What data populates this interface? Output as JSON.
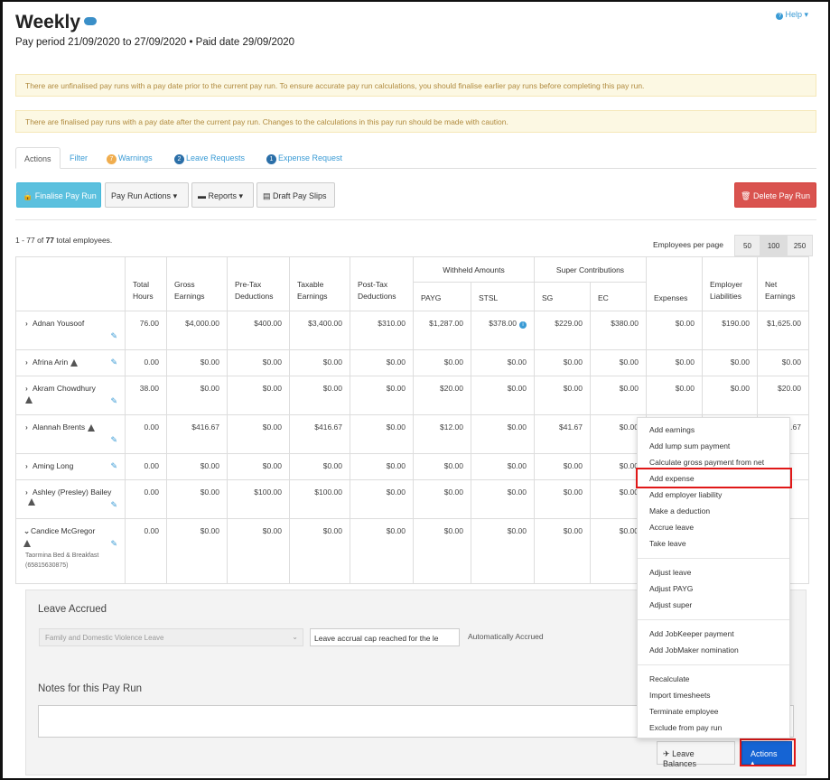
{
  "header": {
    "title": "Weekly",
    "subtitle": "Pay period 21/09/2020 to 27/09/2020 • Paid date 29/09/2020",
    "help": "Help"
  },
  "alerts": [
    "There are unfinalised pay runs with a pay date prior to the current pay run. To ensure accurate pay run calculations, you should finalise earlier pay runs before completing this pay run.",
    "There are finalised pay runs with a pay date after the current pay run. Changes to the calculations in this pay run should be made with caution."
  ],
  "tabs": [
    {
      "label": "Actions",
      "badge": ""
    },
    {
      "label": "Filter",
      "badge": ""
    },
    {
      "label": "Warnings",
      "badge": "7",
      "badge_color": "#f0ad4e"
    },
    {
      "label": "Leave Requests",
      "badge": "2",
      "badge_color": "#2b6fa8"
    },
    {
      "label": "Expense Request",
      "badge": "1",
      "badge_color": "#2b6fa8"
    }
  ],
  "toolbar": {
    "finalise": "Finalise Pay Run",
    "payrun_actions": "Pay Run Actions",
    "reports": "Reports",
    "draft": "Draft Pay Slips",
    "delete": "Delete Pay Run"
  },
  "summary": {
    "count_prefix": "1 - 77 of ",
    "count_total": "77",
    "count_suffix": " total employees.",
    "per_page_label": "Employees per page",
    "per_page_options": [
      "50",
      "100",
      "250"
    ],
    "per_page_selected": "100"
  },
  "table": {
    "headers": {
      "total_hours": "Total Hours",
      "gross": "Gross Earnings",
      "pretax": "Pre-Tax Deductions",
      "taxable": "Taxable Earnings",
      "posttax": "Post-Tax Deductions",
      "withheld": "Withheld Amounts",
      "payg": "PAYG",
      "stsl": "STSL",
      "super": "Super Contributions",
      "sg": "SG",
      "ec": "EC",
      "expenses": "Expenses",
      "employer": "Employer Liabilities",
      "net": "Net Earnings"
    },
    "rows": [
      {
        "name": "Adnan Yousoof",
        "hours": "76.00",
        "gross": "$4,000.00",
        "pretax": "$400.00",
        "taxable": "$3,400.00",
        "posttax": "$310.00",
        "payg": "$1,287.00",
        "stsl": "$378.00",
        "sg": "$229.00",
        "ec": "$380.00",
        "expenses": "$0.00",
        "employer": "$190.00",
        "net": "$1,625.00"
      },
      {
        "name": "Afrina Arin",
        "hours": "0.00",
        "gross": "$0.00",
        "pretax": "$0.00",
        "taxable": "$0.00",
        "posttax": "$0.00",
        "payg": "$0.00",
        "stsl": "$0.00",
        "sg": "$0.00",
        "ec": "$0.00",
        "expenses": "$0.00",
        "employer": "$0.00",
        "net": "$0.00"
      },
      {
        "name": "Akram Chowdhury",
        "hours": "38.00",
        "gross": "$0.00",
        "pretax": "$0.00",
        "taxable": "$0.00",
        "posttax": "$0.00",
        "payg": "$20.00",
        "stsl": "$0.00",
        "sg": "$0.00",
        "ec": "$0.00",
        "expenses": "$0.00",
        "employer": "$0.00",
        "net": "$20.00"
      },
      {
        "name": "Alannah Brents",
        "hours": "0.00",
        "gross": "$416.67",
        "pretax": "$0.00",
        "taxable": "$416.67",
        "posttax": "$0.00",
        "payg": "$12.00",
        "stsl": "$0.00",
        "sg": "$41.67",
        "ec": "$0.00",
        "net": "4.67"
      },
      {
        "name": "Aming Long",
        "hours": "0.00",
        "gross": "$0.00",
        "pretax": "$0.00",
        "taxable": "$0.00",
        "posttax": "$0.00",
        "payg": "$0.00",
        "stsl": "$0.00",
        "sg": "$0.00",
        "ec": "$0.00"
      },
      {
        "name": "Ashley (Presley) Bailey",
        "hours": "0.00",
        "gross": "$0.00",
        "pretax": "$100.00",
        "taxable": "$100.00",
        "posttax": "$0.00",
        "payg": "$0.00",
        "stsl": "$0.00",
        "sg": "$0.00",
        "ec": "$0.00"
      },
      {
        "name": "Candice McGregor",
        "sub": "Taormina Bed & Breakfast (65815630875)",
        "hours": "0.00",
        "gross": "$0.00",
        "pretax": "$0.00",
        "taxable": "$0.00",
        "posttax": "$0.00",
        "payg": "$0.00",
        "stsl": "$0.00",
        "sg": "$0.00",
        "ec": "$0.00"
      }
    ]
  },
  "panel": {
    "leave_title": "Leave Accrued",
    "leave_type": "Family and Domestic Violence Leave",
    "leave_note": "Leave accrual cap reached for the le",
    "auto": "Automatically Accrued",
    "notes_title": "Notes for this Pay Run",
    "leave_balances": "Leave Balances",
    "actions": "Actions"
  },
  "menu": {
    "items": [
      "Add earnings",
      "Add lump sum payment",
      "Calculate gross payment from net",
      "Add expense",
      "Add employer liability",
      "Make a deduction",
      "Accrue leave",
      "Take leave",
      "Adjust leave",
      "Adjust PAYG",
      "Adjust super",
      "Add JobKeeper payment",
      "Add JobMaker nomination",
      "Recalculate",
      "Import timesheets",
      "Terminate employee",
      "Exclude from pay run"
    ],
    "highlighted": "Add expense"
  },
  "colors": {
    "link": "#3a9bd5",
    "primary": "#5bc0de",
    "danger": "#d9534f",
    "actions": "#1564d4",
    "highlight": "#e01818",
    "alert_bg": "#fcf8e3"
  }
}
